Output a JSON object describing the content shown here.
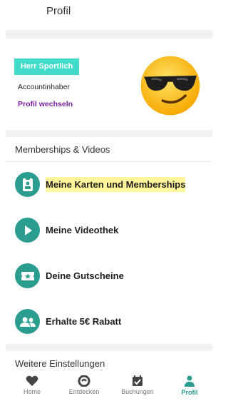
{
  "header": {
    "title": "Profil"
  },
  "profile": {
    "name": "Herr Sportlich",
    "role": "Accountinhaber",
    "switch_label": "Profil wechseln",
    "avatar": "sunglasses-emoji"
  },
  "sections": {
    "memberships_title": "Memberships & Videos",
    "more_settings_title": "Weitere Einstellungen"
  },
  "menu": [
    {
      "label": "Meine Karten und Memberships",
      "icon": "id-badge-icon",
      "highlighted": true
    },
    {
      "label": "Meine Videothek",
      "icon": "play-icon"
    },
    {
      "label": "Deine Gutscheine",
      "icon": "voucher-star-icon"
    },
    {
      "label": "Erhalte 5€ Rabatt",
      "icon": "people-icon"
    }
  ],
  "bottom_nav": [
    {
      "label": "Home",
      "icon": "heart-icon"
    },
    {
      "label": "Entdecken",
      "icon": "discover-icon"
    },
    {
      "label": "Buchungen",
      "icon": "calendar-check-icon"
    },
    {
      "label": "Profil",
      "icon": "person-icon",
      "active": true
    }
  ],
  "colors": {
    "accent": "#2a9d8f",
    "badge": "#40dcc9",
    "link": "#7a1fa2",
    "highlight": "#fff59a"
  }
}
